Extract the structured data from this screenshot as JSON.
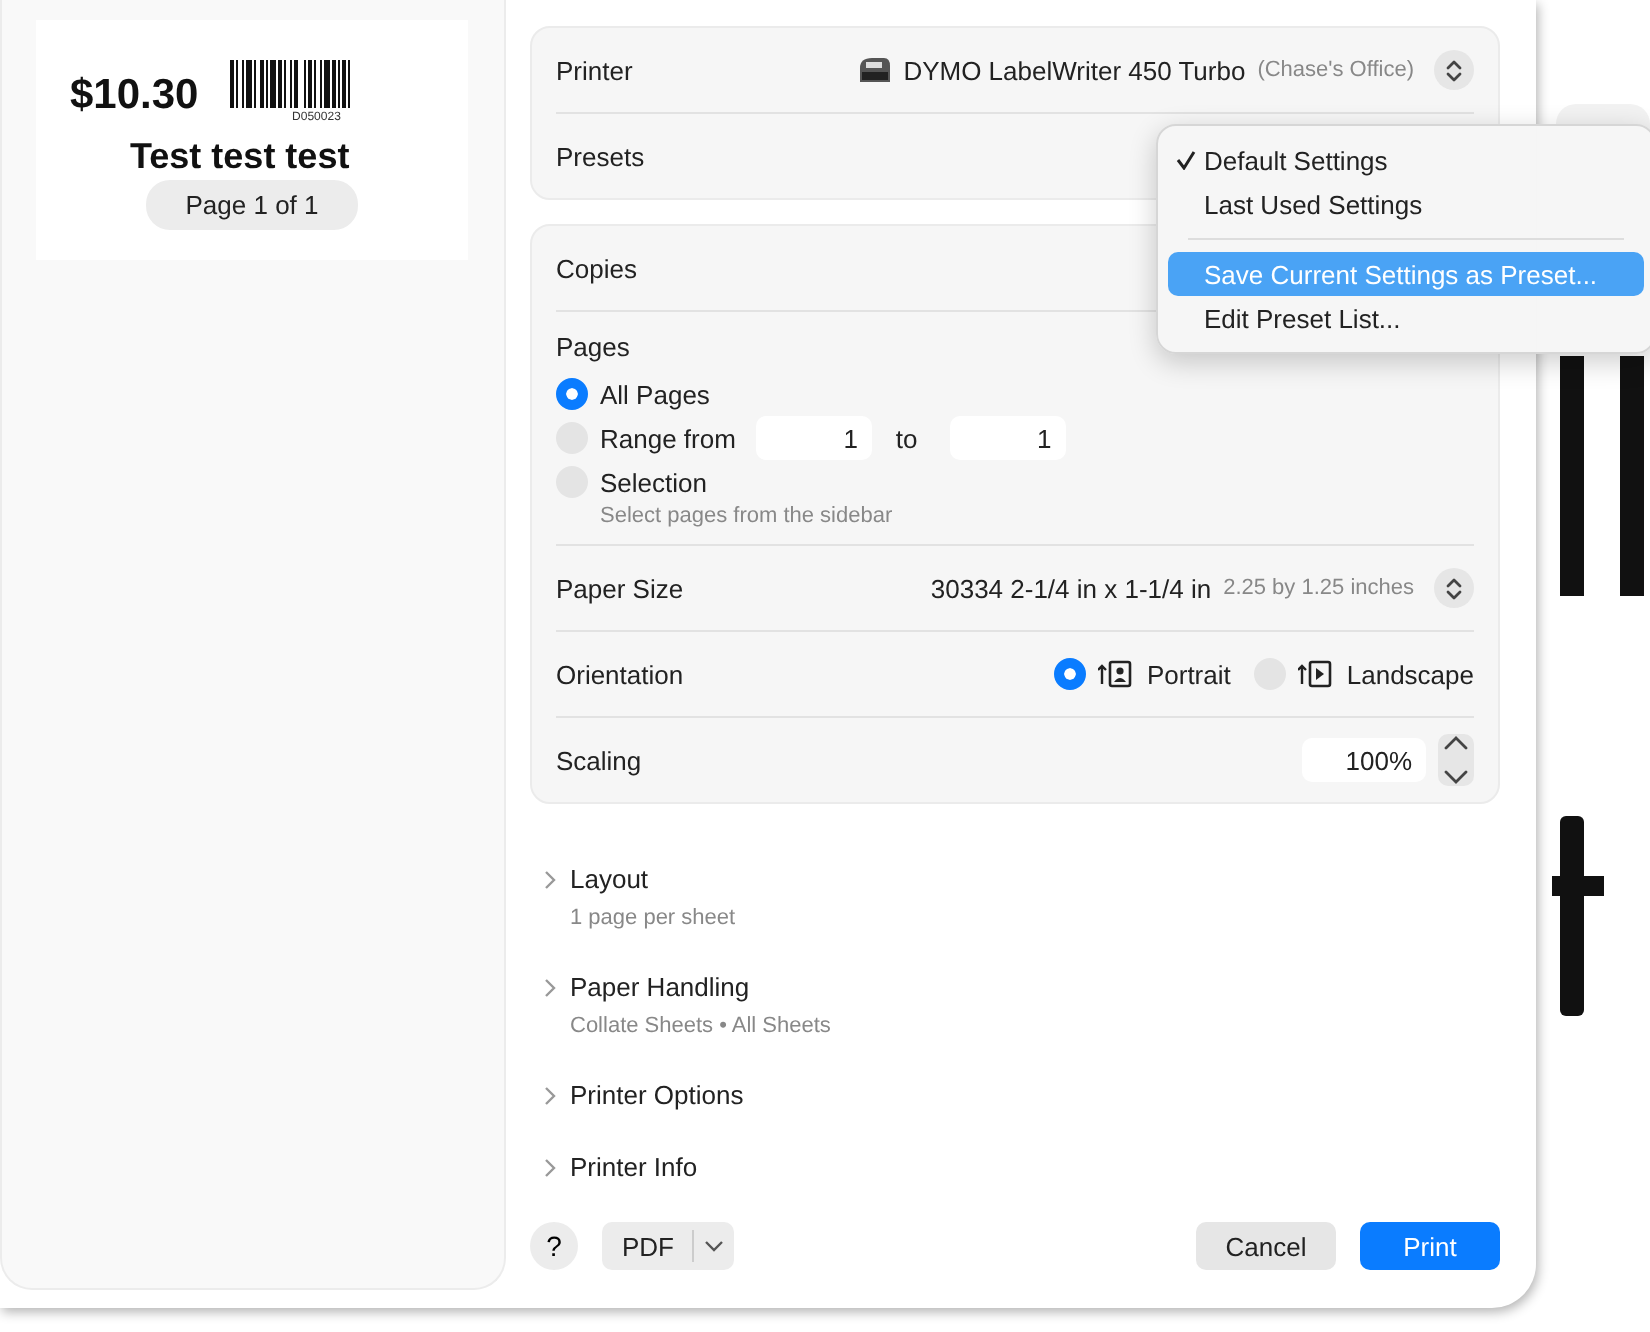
{
  "preview": {
    "price": "$10.30",
    "barcode_number": "D050023",
    "title": "Test test test",
    "page_label": "Page 1 of 1"
  },
  "printer": {
    "label": "Printer",
    "name": "DYMO LabelWriter 450 Turbo",
    "location": "(Chase's Office)"
  },
  "presets": {
    "label": "Presets",
    "menu": [
      {
        "kind": "item",
        "label": "Default Settings",
        "checked": true,
        "selected": false
      },
      {
        "kind": "item",
        "label": "Last Used Settings",
        "checked": false,
        "selected": false
      },
      {
        "kind": "separator"
      },
      {
        "kind": "item",
        "label": "Save Current Settings as Preset...",
        "checked": false,
        "selected": true
      },
      {
        "kind": "item",
        "label": "Edit Preset List...",
        "checked": false,
        "selected": false
      }
    ]
  },
  "copies": {
    "label": "Copies"
  },
  "pages": {
    "label": "Pages",
    "options": [
      {
        "kind": "plain",
        "label": "All Pages",
        "selected": true
      },
      {
        "kind": "range",
        "label": "Range from",
        "selected": false,
        "from": "1",
        "to_label": "to",
        "to": "1"
      },
      {
        "kind": "hint",
        "label": "Selection",
        "selected": false,
        "hint": "Select pages from the sidebar"
      }
    ]
  },
  "paper_size": {
    "label": "Paper Size",
    "value": "30334 2-1/4 in x 1-1/4 in",
    "detail": "2.25 by 1.25 inches"
  },
  "orientation": {
    "label": "Orientation",
    "options": [
      {
        "kind": "portrait",
        "label": "Portrait",
        "selected": true
      },
      {
        "kind": "landscape",
        "label": "Landscape",
        "selected": false
      }
    ]
  },
  "scaling": {
    "label": "Scaling",
    "value": "100%"
  },
  "sections": [
    {
      "title": "Layout",
      "summary": "1 page per sheet",
      "expanded": false
    },
    {
      "title": "Paper Handling",
      "summary": "Collate Sheets • All Sheets",
      "expanded": false
    },
    {
      "title": "Printer Options",
      "expanded": false
    },
    {
      "title": "Printer Info",
      "expanded": false
    }
  ],
  "buttons": {
    "help": "?",
    "pdf": "PDF",
    "cancel": "Cancel",
    "print": "Print"
  }
}
